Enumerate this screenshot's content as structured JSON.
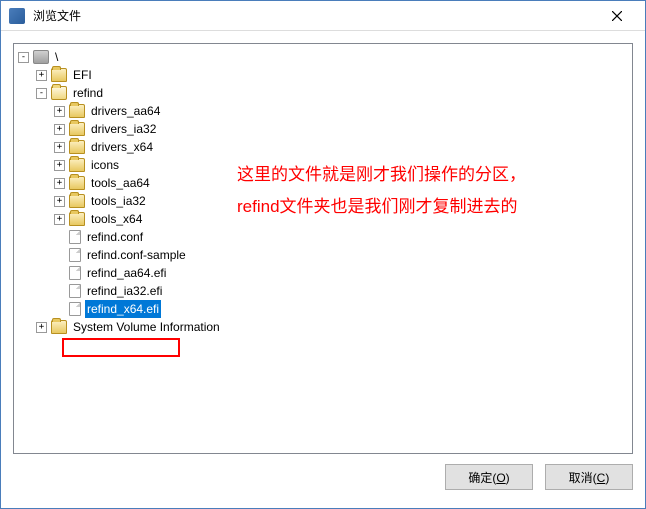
{
  "titlebar": {
    "title": "浏览文件"
  },
  "tree": {
    "root": {
      "label": "\\",
      "expander": "-"
    },
    "efi": {
      "label": "EFI",
      "expander": "+"
    },
    "refind": {
      "label": "refind",
      "expander": "-"
    },
    "drivers_aa64": {
      "label": "drivers_aa64",
      "expander": "+"
    },
    "drivers_ia32": {
      "label": "drivers_ia32",
      "expander": "+"
    },
    "drivers_x64": {
      "label": "drivers_x64",
      "expander": "+"
    },
    "icons": {
      "label": "icons",
      "expander": "+"
    },
    "tools_aa64": {
      "label": "tools_aa64",
      "expander": "+"
    },
    "tools_ia32": {
      "label": "tools_ia32",
      "expander": "+"
    },
    "tools_x64": {
      "label": "tools_x64",
      "expander": "+"
    },
    "refind_conf": {
      "label": "refind.conf"
    },
    "refind_conf_sample": {
      "label": "refind.conf-sample"
    },
    "refind_aa64_efi": {
      "label": "refind_aa64.efi"
    },
    "refind_ia32_efi": {
      "label": "refind_ia32.efi"
    },
    "refind_x64_efi": {
      "label": "refind_x64.efi"
    },
    "svi": {
      "label": "System Volume Information",
      "expander": "+"
    }
  },
  "annotation": {
    "line1": "这里的文件就是刚才我们操作的分区，",
    "line2": "refind文件夹也是我们刚才复制进去的"
  },
  "buttons": {
    "ok_prefix": "确定(",
    "ok_key": "O",
    "ok_suffix": ")",
    "cancel_prefix": "取消(",
    "cancel_key": "C",
    "cancel_suffix": ")"
  }
}
